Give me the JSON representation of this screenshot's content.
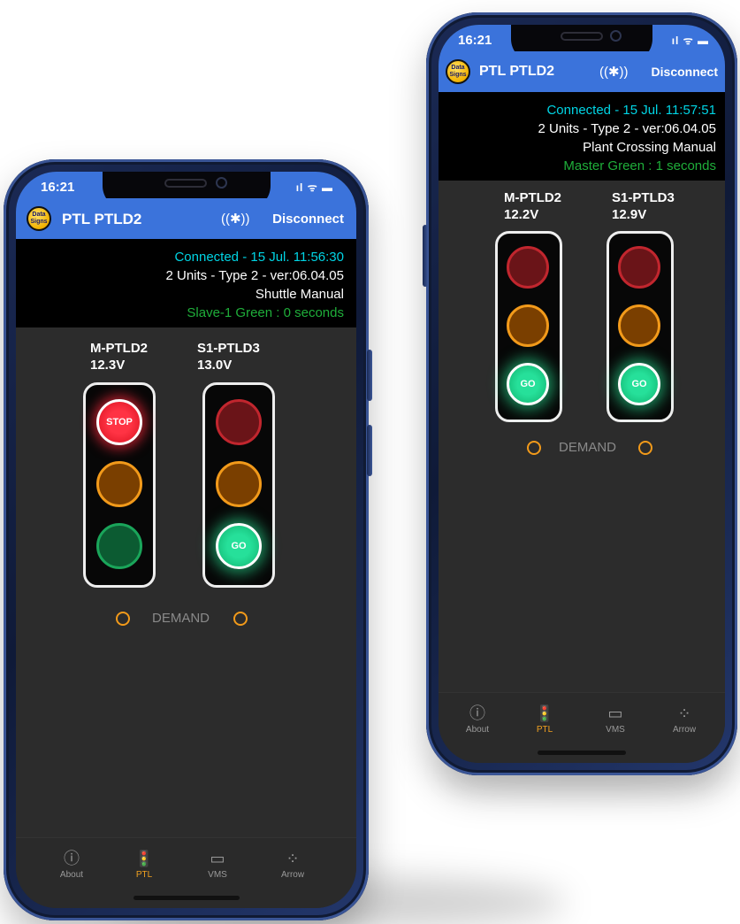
{
  "phones": [
    {
      "status_time": "16:21",
      "sys_icons": "ıl ᯤ ▬",
      "logo_text": [
        "Data",
        "Signs"
      ],
      "app_title": "PTL PTLD2",
      "bluetooth_icon": "((✱))",
      "disconnect_label": "Disconnect",
      "connected_text": "Connected - 15 Jul. 11:56:30",
      "units_text": "2 Units - Type 2 - ver:06.04.05",
      "mode_text": "Shuttle Manual",
      "timer_text": "Slave-1 Green : 0 seconds",
      "units": [
        {
          "name": "M-PTLD2",
          "voltage": "12.3V",
          "red_label": "STOP",
          "green_label": ""
        },
        {
          "name": "S1-PTLD3",
          "voltage": "13.0V",
          "red_label": "",
          "green_label": "GO"
        }
      ],
      "demand_label": "DEMAND",
      "nav": [
        {
          "icon": "info-icon",
          "glyph": "ⓘ",
          "label": "About"
        },
        {
          "icon": "traffic-light-icon",
          "glyph": "🚦",
          "label": "PTL"
        },
        {
          "icon": "monitor-icon",
          "glyph": "▭",
          "label": "VMS"
        },
        {
          "icon": "arrow-icon",
          "glyph": "⁘",
          "label": "Arrow"
        }
      ]
    },
    {
      "status_time": "16:21",
      "sys_icons": "ıl ᯤ ▬",
      "logo_text": [
        "Data",
        "Signs"
      ],
      "app_title": "PTL PTLD2",
      "bluetooth_icon": "((✱))",
      "disconnect_label": "Disconnect",
      "connected_text": "Connected - 15 Jul. 11:57:51",
      "units_text": "2 Units - Type 2 - ver:06.04.05",
      "mode_text": "Plant Crossing Manual",
      "timer_text": "Master Green : 1 seconds",
      "units": [
        {
          "name": "M-PTLD2",
          "voltage": "12.2V",
          "red_label": "",
          "green_label": "GO"
        },
        {
          "name": "S1-PTLD3",
          "voltage": "12.9V",
          "red_label": "",
          "green_label": "GO"
        }
      ],
      "demand_label": "DEMAND",
      "nav": [
        {
          "icon": "info-icon",
          "glyph": "ⓘ",
          "label": "About"
        },
        {
          "icon": "traffic-light-icon",
          "glyph": "🚦",
          "label": "PTL"
        },
        {
          "icon": "monitor-icon",
          "glyph": "▭",
          "label": "VMS"
        },
        {
          "icon": "arrow-icon",
          "glyph": "⁘",
          "label": "Arrow"
        }
      ]
    }
  ]
}
